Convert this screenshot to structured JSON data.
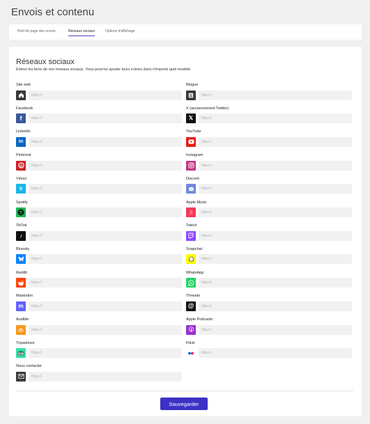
{
  "page": {
    "title": "Envois et contenu"
  },
  "tabs": [
    {
      "label": "Pied de page des envois"
    },
    {
      "label": "Réseaux sociaux"
    },
    {
      "label": "Options d'affichage"
    }
  ],
  "section": {
    "title": "Réseaux sociaux",
    "description": "Entrez les liens de vos réseaux sociaux. Vous pourrez ajouter leurs icônes dans n'importe quel modèle."
  },
  "networks": [
    {
      "label": "Site web",
      "placeholder": "https://",
      "icon": "home-icon",
      "color": "#3a3a3a"
    },
    {
      "label": "Blogue",
      "placeholder": "https://",
      "icon": "blog-icon",
      "color": "#3a3a3a"
    },
    {
      "label": "Facebook",
      "placeholder": "https://",
      "icon": "facebook-icon",
      "color": "#3b5998"
    },
    {
      "label": "X (anciennement Twitter)",
      "placeholder": "https://",
      "icon": "x-twitter-icon",
      "color": "#111111"
    },
    {
      "label": "LinkedIn",
      "placeholder": "https://",
      "icon": "linkedin-icon",
      "color": "#0a66c2"
    },
    {
      "label": "YouTube",
      "placeholder": "https://",
      "icon": "youtube-icon",
      "color": "#e62117"
    },
    {
      "label": "Pinterest",
      "placeholder": "https://",
      "icon": "pinterest-icon",
      "color": "#cb2027"
    },
    {
      "label": "Instagram",
      "placeholder": "https://",
      "icon": "instagram-icon",
      "color": "#c13584"
    },
    {
      "label": "Vimeo",
      "placeholder": "https://",
      "icon": "vimeo-icon",
      "color": "#1ab7ea"
    },
    {
      "label": "Discord",
      "placeholder": "https://",
      "icon": "discord-icon",
      "color": "#7289da"
    },
    {
      "label": "Spotify",
      "placeholder": "https://",
      "icon": "spotify-icon",
      "color": "#1db954"
    },
    {
      "label": "Apple Music",
      "placeholder": "https://",
      "icon": "apple-music-icon",
      "color": "#f53b57"
    },
    {
      "label": "TikTok",
      "placeholder": "https://",
      "icon": "tiktok-icon",
      "color": "#111111"
    },
    {
      "label": "Twitch",
      "placeholder": "https://",
      "icon": "twitch-icon",
      "color": "#9146ff"
    },
    {
      "label": "Bluesky",
      "placeholder": "https://",
      "icon": "bluesky-icon",
      "color": "#1185fe"
    },
    {
      "label": "Snapchat",
      "placeholder": "https://",
      "icon": "snapchat-icon",
      "color": "#fffc00"
    },
    {
      "label": "Reddit",
      "placeholder": "https://",
      "icon": "reddit-icon",
      "color": "#ff4500"
    },
    {
      "label": "WhatsApp",
      "placeholder": "https://",
      "icon": "whatsapp-icon",
      "color": "#25d366"
    },
    {
      "label": "Mastodon",
      "placeholder": "https://",
      "icon": "mastodon-icon",
      "color": "#6364ff"
    },
    {
      "label": "Threads",
      "placeholder": "https://",
      "icon": "threads-icon",
      "color": "#111111"
    },
    {
      "label": "Audible",
      "placeholder": "https://",
      "icon": "audible-icon",
      "color": "#f8991c"
    },
    {
      "label": "Apple Podcasts",
      "placeholder": "https://",
      "icon": "apple-podcasts-icon",
      "color": "#9933cc"
    },
    {
      "label": "Tripadvisor",
      "placeholder": "https://",
      "icon": "tripadvisor-icon",
      "color": "#34e0a1"
    },
    {
      "label": "Flickr",
      "placeholder": "https://",
      "icon": "flickr-icon",
      "color": "#ffffff"
    },
    {
      "label": "Nous contacter",
      "placeholder": "https://",
      "icon": "mail-icon",
      "color": "#3a3a3a"
    }
  ],
  "actions": {
    "save_label": "Sauvegarder"
  },
  "colors": {
    "accent": "#3c31c4",
    "background": "#f0f0f0"
  }
}
